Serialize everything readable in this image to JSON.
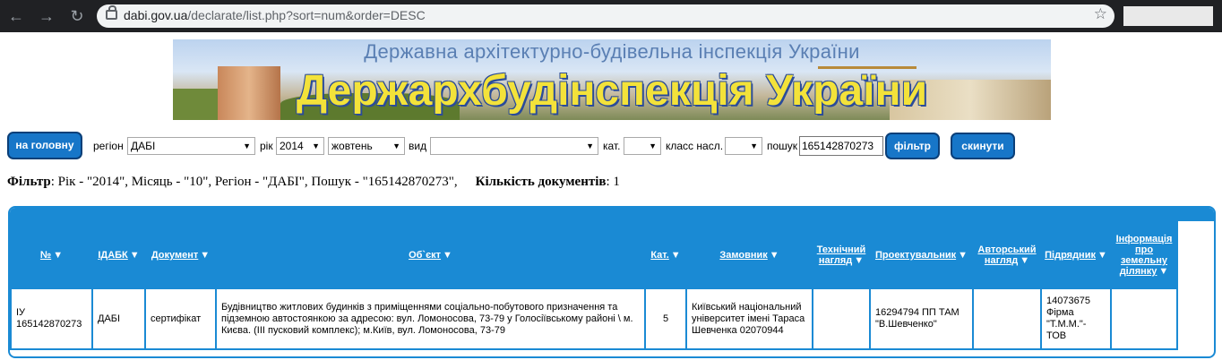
{
  "browser": {
    "url_host": "dabi.gov.ua",
    "url_path": "/declarate/list.php?sort=num&order=DESC"
  },
  "banner": {
    "subtitle": "Державна архітектурно-будівельна інспекція України",
    "title": "Держархбудінспекція України"
  },
  "toolbar": {
    "home_label": "на головну",
    "region_label": "регіон",
    "region_value": "ДАБІ",
    "year_label": "рік",
    "year_value": "2014",
    "month_value": "жовтень",
    "type_label": "вид",
    "type_value": "",
    "cat_label": "кат.",
    "cat_value": "",
    "class_label": "класс насл.",
    "class_value": "",
    "search_label": "пошук",
    "search_value": "165142870273",
    "filter_label": "фільтр",
    "reset_label": "скинути"
  },
  "filter_summary": {
    "filter_label": "Фільтр",
    "filter_text": ": Рік - \"2014\", Місяць - \"10\", Регіон - \"ДАБІ\", Пошук - \"165142870273\",",
    "count_label": "Кількість документів",
    "count_value": ": 1"
  },
  "table": {
    "headers": {
      "num": "№",
      "idabk": "ІДАБК",
      "doc": "Документ",
      "object": "Об`єкт",
      "cat": "Кат.",
      "customer": "Замовник",
      "tech1": "Технічний",
      "tech2": "нагляд",
      "designer": "Проектувальник",
      "author1": "Авторський",
      "author2": "нагляд",
      "contractor": "Підрядник",
      "land1": "Інформація",
      "land2": "про",
      "land3": "земельну",
      "land4": "ділянку"
    },
    "row": {
      "num1": "ІУ",
      "num2": "165142870273",
      "idabk": "ДАБІ",
      "doc": "сертифікат",
      "object": "Будівництво житлових будинків з приміщеннями соціально-побутового призначення та підземною автостоянкою за адресою: вул. Ломоносова, 73-79 у Голосіївському районі \\ м. Києва. (ІІІ пусковий комплекс); м.Київ, вул. Ломоносова, 73-79",
      "cat": "5",
      "customer": "Київський національний університет імені Тараса Шевченка 02070944",
      "tech": "",
      "designer": "16294794 ПП ТАМ \"В.Шевченко\"",
      "author": "",
      "contractor": "14073675 Фірма \"Т.М.М.\"-ТОВ",
      "land": ""
    }
  }
}
